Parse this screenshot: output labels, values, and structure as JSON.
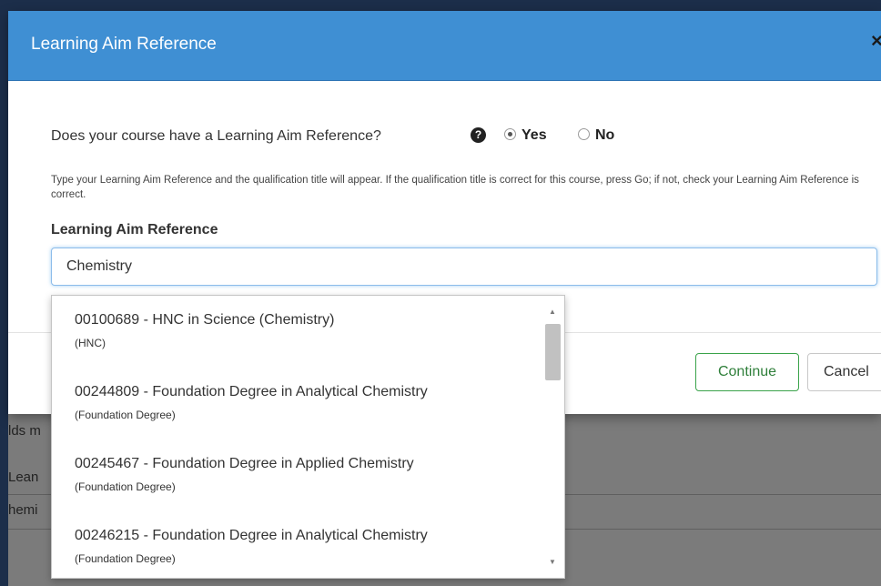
{
  "modal": {
    "title": "Learning Aim Reference",
    "close_symbol": "×",
    "question": "Does your course have a Learning Aim Reference?",
    "help_icon": "question-circle-icon",
    "radio_yes_label": "Yes",
    "radio_no_label": "No",
    "radio_selected": "Yes",
    "instructions": "Type your Learning Aim Reference and the qualification title will appear. If the qualification title is correct for this course, press Go; if not, check your Learning Aim Reference is correct.",
    "field_label": "Learning Aim Reference",
    "input_value": "Chemistry",
    "continue_label": "Continue",
    "cancel_label": "Cancel"
  },
  "autocomplete": {
    "items": [
      {
        "title": "00100689 - HNC in Science (Chemistry)",
        "type": "(HNC)"
      },
      {
        "title": "00244809 - Foundation Degree in Analytical Chemistry",
        "type": "(Foundation Degree)"
      },
      {
        "title": "00245467 - Foundation Degree in Applied Chemistry",
        "type": "(Foundation Degree)"
      },
      {
        "title": "00246215 - Foundation Degree in Analytical Chemistry",
        "type": "(Foundation Degree)"
      }
    ]
  },
  "background": {
    "fragments": [
      "lds m",
      "Lean",
      "hemi"
    ]
  },
  "colors": {
    "header": "#3f8fd3",
    "continue_border": "#3aa34a",
    "overlay": "#8a8a8a"
  }
}
